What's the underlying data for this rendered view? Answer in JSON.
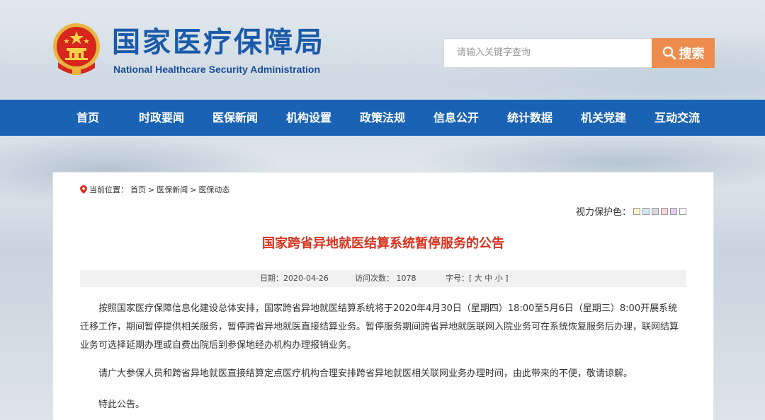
{
  "header": {
    "logo_cn": "国家医疗保障局",
    "logo_en": "National Healthcare Security Administration"
  },
  "search": {
    "placeholder": "请输入关键字查询",
    "button_label": "搜索"
  },
  "nav": {
    "items": [
      "首页",
      "时政要闻",
      "医保新闻",
      "机构设置",
      "政策法规",
      "信息公开",
      "统计数据",
      "机关党建",
      "互动交流"
    ]
  },
  "breadcrumb": {
    "prefix": "当前位置：",
    "items": [
      "首页",
      ">",
      "医保新闻",
      ">",
      "医保动态"
    ]
  },
  "vision": {
    "label": "视力保护色：",
    "colors": [
      "#faf7cc",
      "#cfe6f3",
      "#d9d9d9",
      "#f6d6dc",
      "#e6d0f1",
      "#ffffff"
    ]
  },
  "article": {
    "title": "国家跨省异地就医结算系统暂停服务的公告",
    "date_label": "日期：2020-04-26",
    "visits_label": "访问次数：  1078",
    "font_label": "字号：[ 大 中 小 ]",
    "paragraphs": [
      "按照国家医疗保障信息化建设总体安排，国家跨省异地就医结算系统将于2020年4月30日（星期四）18:00至5月6日（星期三）8:00开展系统迁移工作，期间暂停提供相关服务，暂停跨省异地就医直接结算业务。暂停服务期间跨省异地就医联网入院业务可在系统恢复服务后办理，联网结算业务可选择延期办理或自费出院后到参保地经办机构办理报销业务。",
      "请广大参保人员和跨省异地就医直接结算定点医疗机构合理安排跨省异地就医相关联网业务办理时间，由此带来的不便，敬请谅解。",
      "特此公告。"
    ]
  },
  "colors": {
    "nav_blue": "#1a63b4",
    "search_orange": "#ee8c4e",
    "title_red": "#d6321e"
  }
}
